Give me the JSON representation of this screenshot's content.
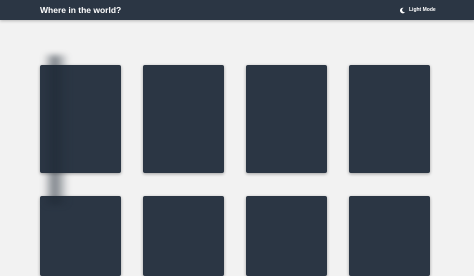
{
  "header": {
    "title": "Where in the world?",
    "mode_label": "Light Mode",
    "mode_icon": "moon-icon"
  },
  "colors": {
    "background": "#f2f2f2",
    "header": "#2b3644",
    "card": "#2b3644",
    "text": "#ffffff"
  },
  "cards": [
    {
      "row": 1,
      "col": 1
    },
    {
      "row": 1,
      "col": 2
    },
    {
      "row": 1,
      "col": 3
    },
    {
      "row": 1,
      "col": 4
    },
    {
      "row": 2,
      "col": 1
    },
    {
      "row": 2,
      "col": 2
    },
    {
      "row": 2,
      "col": 3
    },
    {
      "row": 2,
      "col": 4
    }
  ]
}
